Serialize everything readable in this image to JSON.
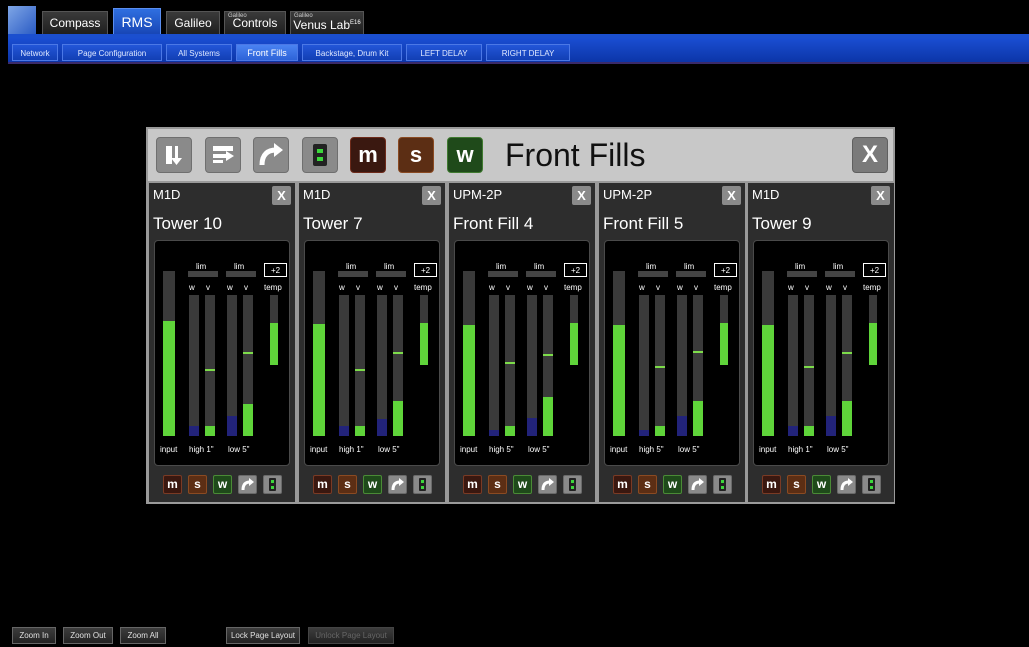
{
  "app_tabs": [
    {
      "label": "Compass",
      "active": false,
      "tiny": ""
    },
    {
      "label": "RMS",
      "active": true,
      "tiny": ""
    },
    {
      "label": "Galileo",
      "active": false,
      "tiny": ""
    },
    {
      "label": "Controls",
      "active": false,
      "tiny": "Galileo"
    },
    {
      "label": "Venus Lab",
      "active": false,
      "tiny": "Galileo",
      "sup": "E16"
    }
  ],
  "sub_tabs": [
    {
      "label": "Network"
    },
    {
      "label": "Page Configuration"
    },
    {
      "label": "All Systems"
    },
    {
      "label": "Front Fills"
    },
    {
      "label": "Backstage, Drum Kit"
    },
    {
      "label": "LEFT DELAY"
    },
    {
      "label": "RIGHT DELAY"
    }
  ],
  "panel": {
    "title": "Front Fills",
    "header_buttons": {
      "m": "m",
      "s": "s",
      "w": "w"
    },
    "close": "X"
  },
  "meter_labels": {
    "lim": "lim",
    "w": "w",
    "v": "v",
    "temp": "temp",
    "input": "input",
    "trim": "+2"
  },
  "strip_buttons": {
    "m": "m",
    "s": "s",
    "w": "w"
  },
  "strips": [
    {
      "model": "M1D",
      "name": "Tower 10",
      "close": "X",
      "high": "high 1\"",
      "low": "low 5\"",
      "levels": {
        "input": 0.7,
        "high_w": 0.07,
        "high_v": 0.07,
        "high_mark": 0.46,
        "low_w": 0.14,
        "low_v": 0.23,
        "low_mark": 0.58,
        "temp": 0.6
      }
    },
    {
      "model": "M1D",
      "name": "Tower 7",
      "close": "X",
      "high": "high 1\"",
      "low": "low 5\"",
      "levels": {
        "input": 0.68,
        "high_w": 0.07,
        "high_v": 0.07,
        "high_mark": 0.46,
        "low_w": 0.12,
        "low_v": 0.25,
        "low_mark": 0.58,
        "temp": 0.6
      }
    },
    {
      "model": "UPM-2P",
      "name": "Front Fill 4",
      "close": "X",
      "high": "high 5\"",
      "low": "low 5\"",
      "levels": {
        "input": 0.67,
        "high_w": 0.04,
        "high_v": 0.07,
        "high_mark": 0.51,
        "low_w": 0.13,
        "low_v": 0.28,
        "low_mark": 0.57,
        "temp": 0.6
      }
    },
    {
      "model": "UPM-2P",
      "name": "Front Fill 5",
      "close": "X",
      "high": "high 5\"",
      "low": "low 5\"",
      "levels": {
        "input": 0.67,
        "high_w": 0.04,
        "high_v": 0.07,
        "high_mark": 0.48,
        "low_w": 0.14,
        "low_v": 0.25,
        "low_mark": 0.59,
        "temp": 0.6
      }
    },
    {
      "model": "M1D",
      "name": "Tower 9",
      "close": "X",
      "high": "high 1\"",
      "low": "low 5\"",
      "levels": {
        "input": 0.67,
        "high_w": 0.07,
        "high_v": 0.07,
        "high_mark": 0.48,
        "low_w": 0.14,
        "low_v": 0.25,
        "low_mark": 0.58,
        "temp": 0.6
      }
    }
  ],
  "bottom_buttons": {
    "zoom_in": "Zoom In",
    "zoom_out": "Zoom Out",
    "zoom_all": "Zoom All",
    "lock": "Lock Page Layout",
    "unlock": "Unlock Page Layout"
  },
  "colors": {
    "accent_blue": "#1b4fcf",
    "meter_green": "#5fd43a",
    "meter_blue": "#22237a",
    "mute_red": "#3a1810",
    "solo_brown": "#5c2e14",
    "w_green": "#1f4a1a"
  }
}
